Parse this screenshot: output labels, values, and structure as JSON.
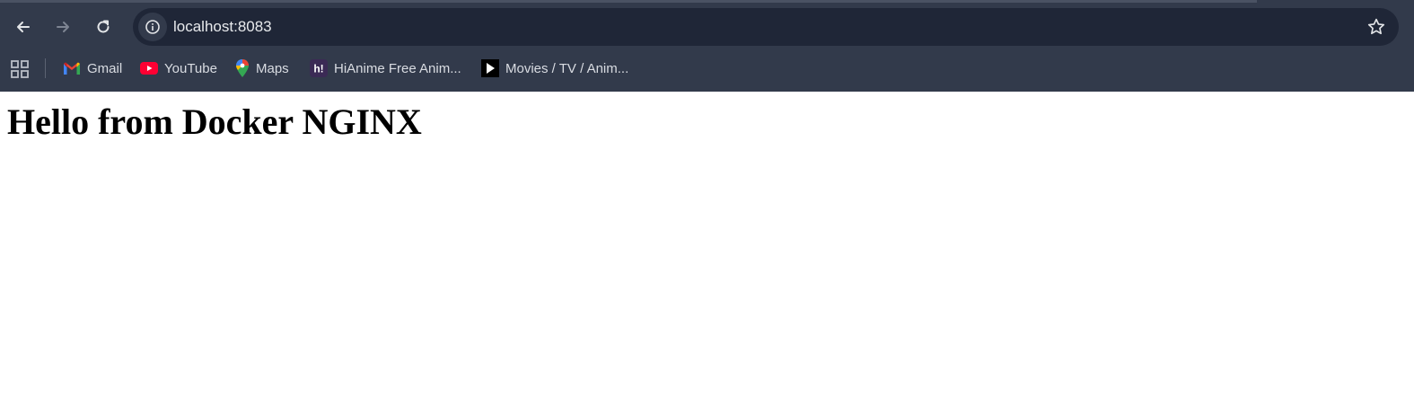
{
  "browser": {
    "address_bar": {
      "url": "localhost:8083"
    },
    "bookmarks": [
      {
        "label": "Gmail",
        "icon": "gmail-icon"
      },
      {
        "label": "YouTube",
        "icon": "youtube-icon"
      },
      {
        "label": "Maps",
        "icon": "maps-icon"
      },
      {
        "label": "HiAnime Free Anim...",
        "icon": "hianime-icon"
      },
      {
        "label": "Movies / TV / Anim...",
        "icon": "play-icon"
      }
    ],
    "colors": {
      "frame": "#323a4b",
      "omnibox": "#1f2637",
      "text": "#e8eaed"
    }
  },
  "page": {
    "heading": "Hello from Docker NGINX"
  }
}
